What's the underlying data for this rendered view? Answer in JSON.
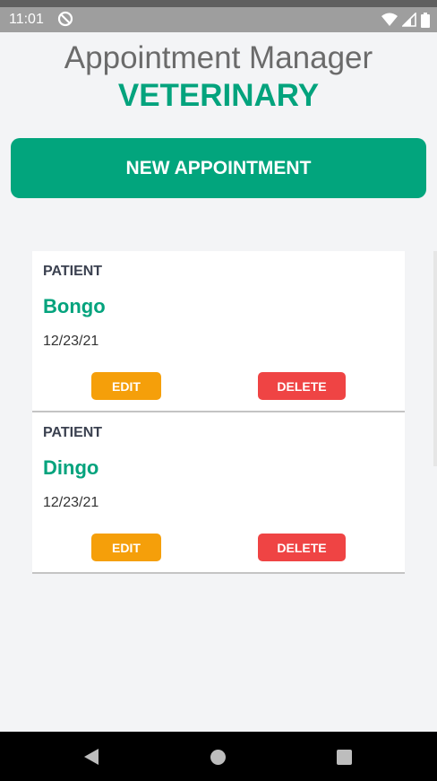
{
  "status": {
    "time": "11:01"
  },
  "header": {
    "title": "Appointment Manager",
    "subtitle": "VETERINARY"
  },
  "actions": {
    "new_appointment": "NEW APPOINTMENT"
  },
  "appointments": [
    {
      "label": "PATIENT",
      "name": "Bongo",
      "date": "12/23/21",
      "edit": "EDIT",
      "delete": "DELETE"
    },
    {
      "label": "PATIENT",
      "name": "Dingo",
      "date": "12/23/21",
      "edit": "EDIT",
      "delete": "DELETE"
    }
  ],
  "colors": {
    "accent": "#02a57d",
    "edit": "#f59f0a",
    "delete": "#ef4444",
    "background": "#f3f4f6"
  },
  "icons": {
    "status": [
      "do-not-disturb-icon",
      "wifi-icon",
      "signal-icon",
      "battery-icon"
    ],
    "nav": [
      "back-icon",
      "home-icon",
      "recents-icon"
    ]
  }
}
